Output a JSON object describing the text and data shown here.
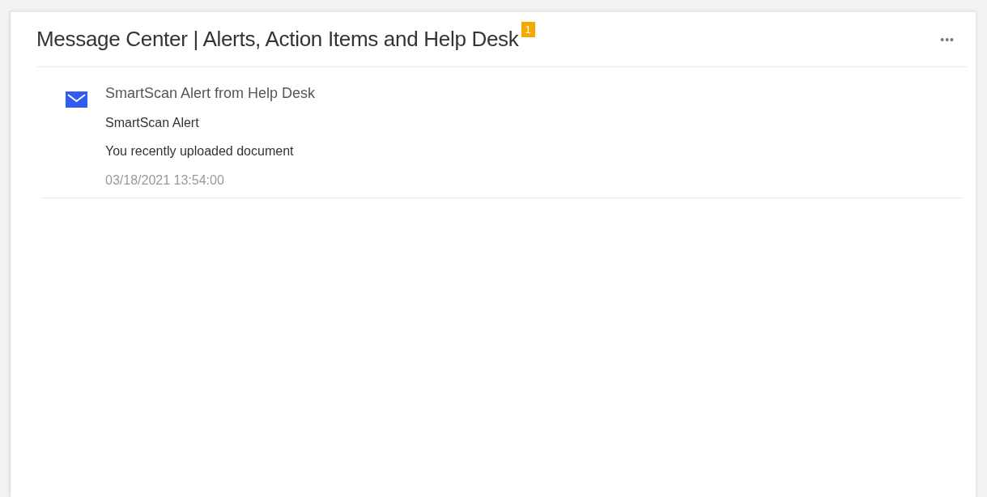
{
  "panel": {
    "title": "Message Center | Alerts, Action Items and Help Desk",
    "badge": "1",
    "menu": "•••"
  },
  "messages": [
    {
      "kind": "mail",
      "subject": "SmartScan Alert from Help Desk",
      "title": "SmartScan Alert",
      "body": "You recently uploaded document",
      "time": "03/18/2021 13:54:00"
    }
  ]
}
